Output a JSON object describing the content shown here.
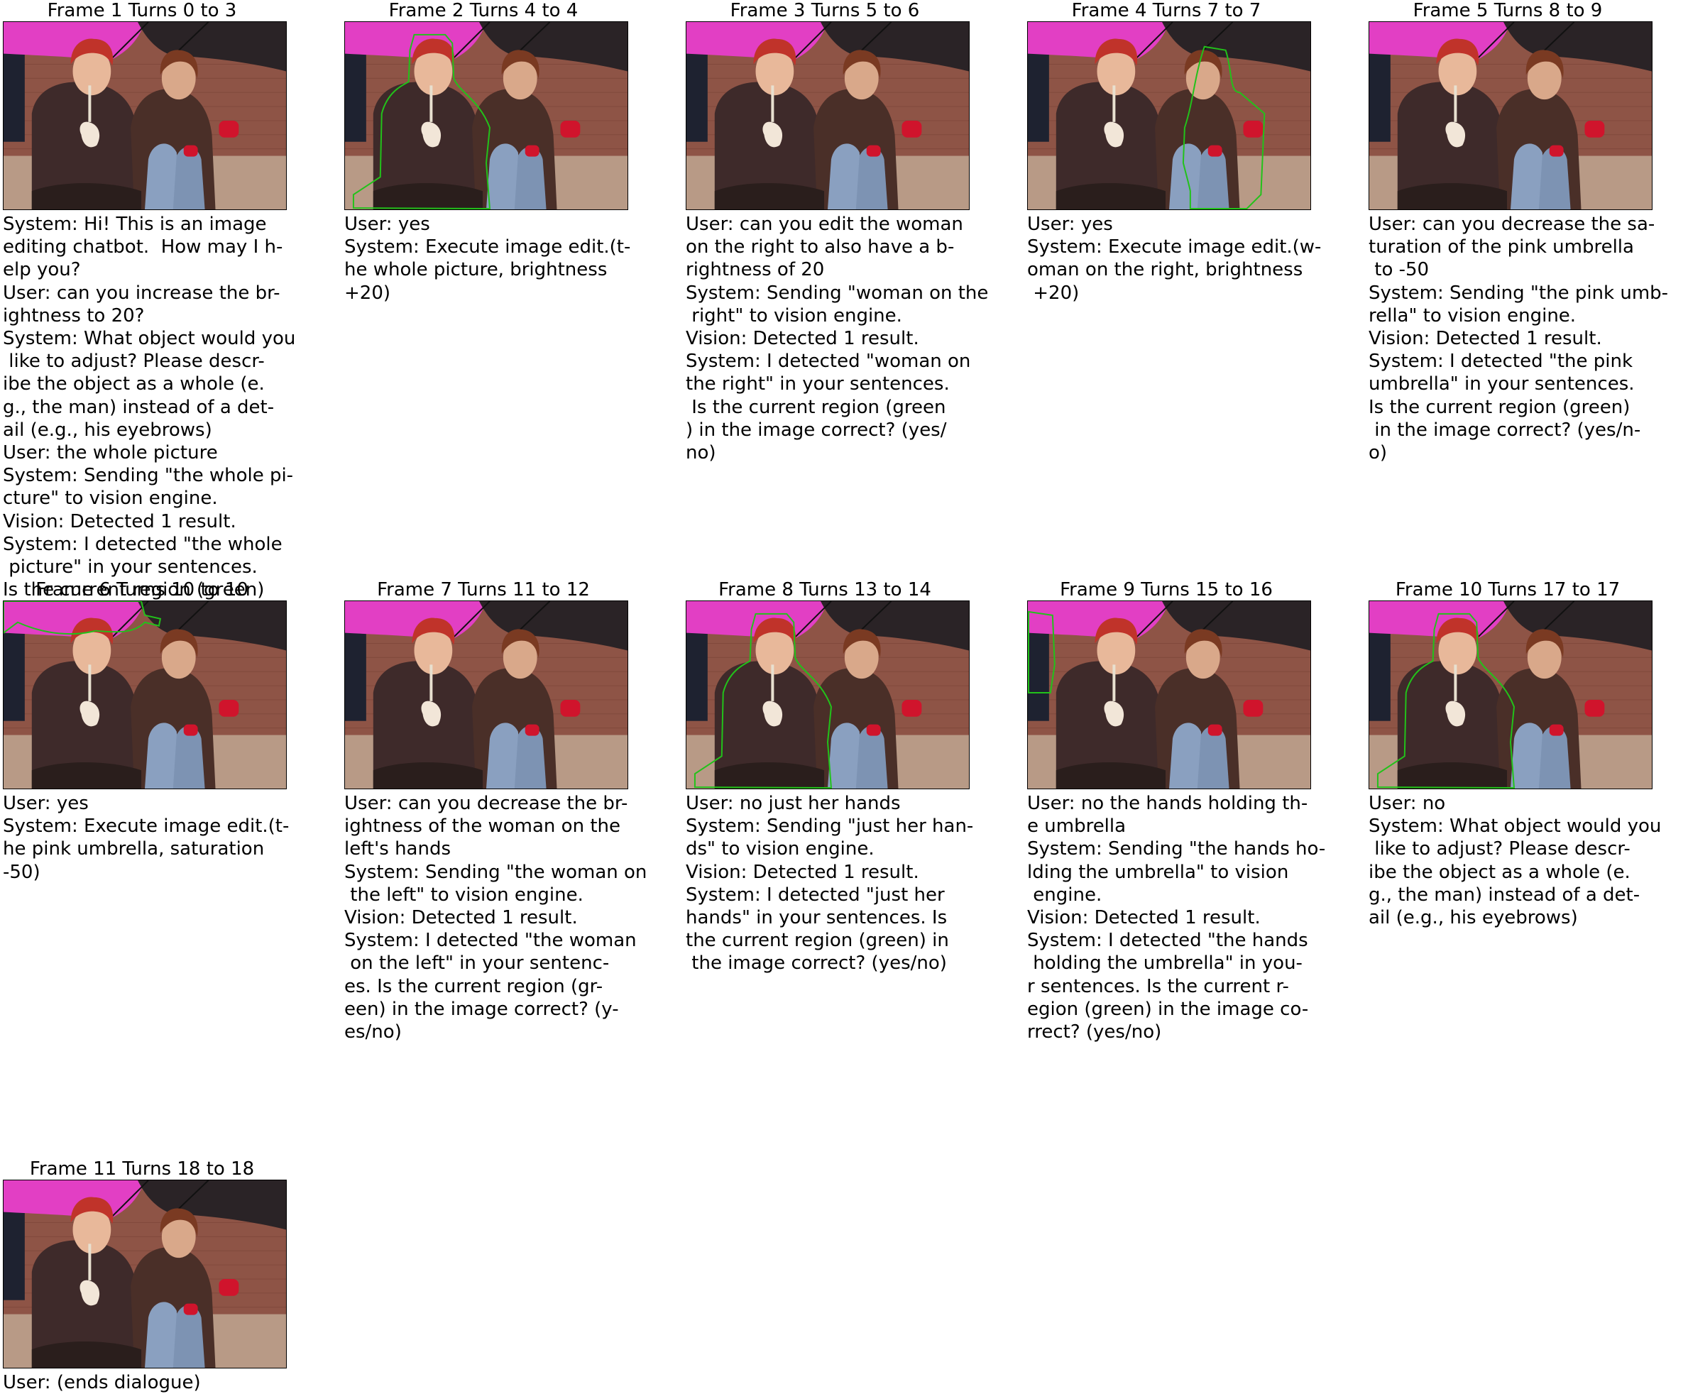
{
  "colors": {
    "umbrella_pink": "#e23fc4",
    "umbrella_dark": "#2a2326",
    "brick": "#8e5446",
    "jacket": "#3e2a2a",
    "hair": "#c0332a",
    "skin": "#e8b89a",
    "jeans": "#8aa0c0",
    "glove_red": "#d0142c",
    "mask_green": "#22c21a"
  },
  "frames": [
    {
      "title": "Frame 1 Turns 0 to 3",
      "mask": "none",
      "dialogue": "System: Hi! This is an image\nediting chatbot.  How may I h-\nelp you?\nUser: can you increase the br-\nightness to 20?\nSystem: What object would you\n like to adjust? Please descr-\nibe the object as a whole (e.\ng., the man) instead of a det-\nail (e.g., his eyebrows)\nUser: the whole picture\nSystem: Sending \"the whole pi-\ncture\" to vision engine.\nVision: Detected 1 result.\nSystem: I detected \"the whole\n picture\" in your sentences.\nIs the current region (green)\n in the image correct? (yes/n-\no)"
    },
    {
      "title": "Frame 2 Turns 4 to 4",
      "mask": "left-woman",
      "dialogue": "User: yes\nSystem: Execute image edit.(t-\nhe whole picture, brightness\n+20)"
    },
    {
      "title": "Frame 3 Turns 5 to 6",
      "mask": "none",
      "dialogue": "User: can you edit the woman\non the right to also have a b-\nrightness of 20\nSystem: Sending \"woman on the\n right\" to vision engine.\nVision: Detected 1 result.\nSystem: I detected \"woman on\nthe right\" in your sentences.\n Is the current region (green\n) in the image correct? (yes/\nno)"
    },
    {
      "title": "Frame 4 Turns 7 to 7",
      "mask": "right-woman",
      "dialogue": "User: yes\nSystem: Execute image edit.(w-\noman on the right, brightness\n +20)"
    },
    {
      "title": "Frame 5 Turns 8 to 9",
      "mask": "none",
      "dialogue": "User: can you decrease the sa-\nturation of the pink umbrella\n to -50\nSystem: Sending \"the pink umb-\nrella\" to vision engine.\nVision: Detected 1 result.\nSystem: I detected \"the pink\numbrella\" in your sentences.\nIs the current region (green)\n in the image correct? (yes/n-\no)"
    },
    {
      "title": "Frame 6 Turns 10 to 10",
      "mask": "pink-umbrella",
      "dialogue": "User: yes\nSystem: Execute image edit.(t-\nhe pink umbrella, saturation\n-50)"
    },
    {
      "title": "Frame 7 Turns 11 to 12",
      "mask": "none",
      "dialogue": "User: can you decrease the br-\nightness of the woman on the\nleft's hands\nSystem: Sending \"the woman on\n the left\" to vision engine.\nVision: Detected 1 result.\nSystem: I detected \"the woman\n on the left\" in your sentenc-\nes. Is the current region (gr-\neen) in the image correct? (y-\nes/no)"
    },
    {
      "title": "Frame 8 Turns 13 to 14",
      "mask": "left-woman",
      "dialogue": "User: no just her hands\nSystem: Sending \"just her han-\nds\" to vision engine.\nVision: Detected 1 result.\nSystem: I detected \"just her\nhands\" in your sentences. Is\nthe current region (green) in\n the image correct? (yes/no)"
    },
    {
      "title": "Frame 9 Turns 15 to 16",
      "mask": "left-edge",
      "dialogue": "User: no the hands holding th-\ne umbrella\nSystem: Sending \"the hands ho-\nlding the umbrella\" to vision\n engine.\nVision: Detected 1 result.\nSystem: I detected \"the hands\n holding the umbrella\" in you-\nr sentences. Is the current r-\negion (green) in the image co-\nrrect? (yes/no)"
    },
    {
      "title": "Frame 10 Turns 17 to 17",
      "mask": "left-woman",
      "dialogue": "User: no\nSystem: What object would you\n like to adjust? Please descr-\nibe the object as a whole (e.\ng., the man) instead of a det-\nail (e.g., his eyebrows)"
    },
    {
      "title": "Frame 11 Turns 18 to 18",
      "mask": "none",
      "dialogue": "User: (ends dialogue)"
    }
  ]
}
